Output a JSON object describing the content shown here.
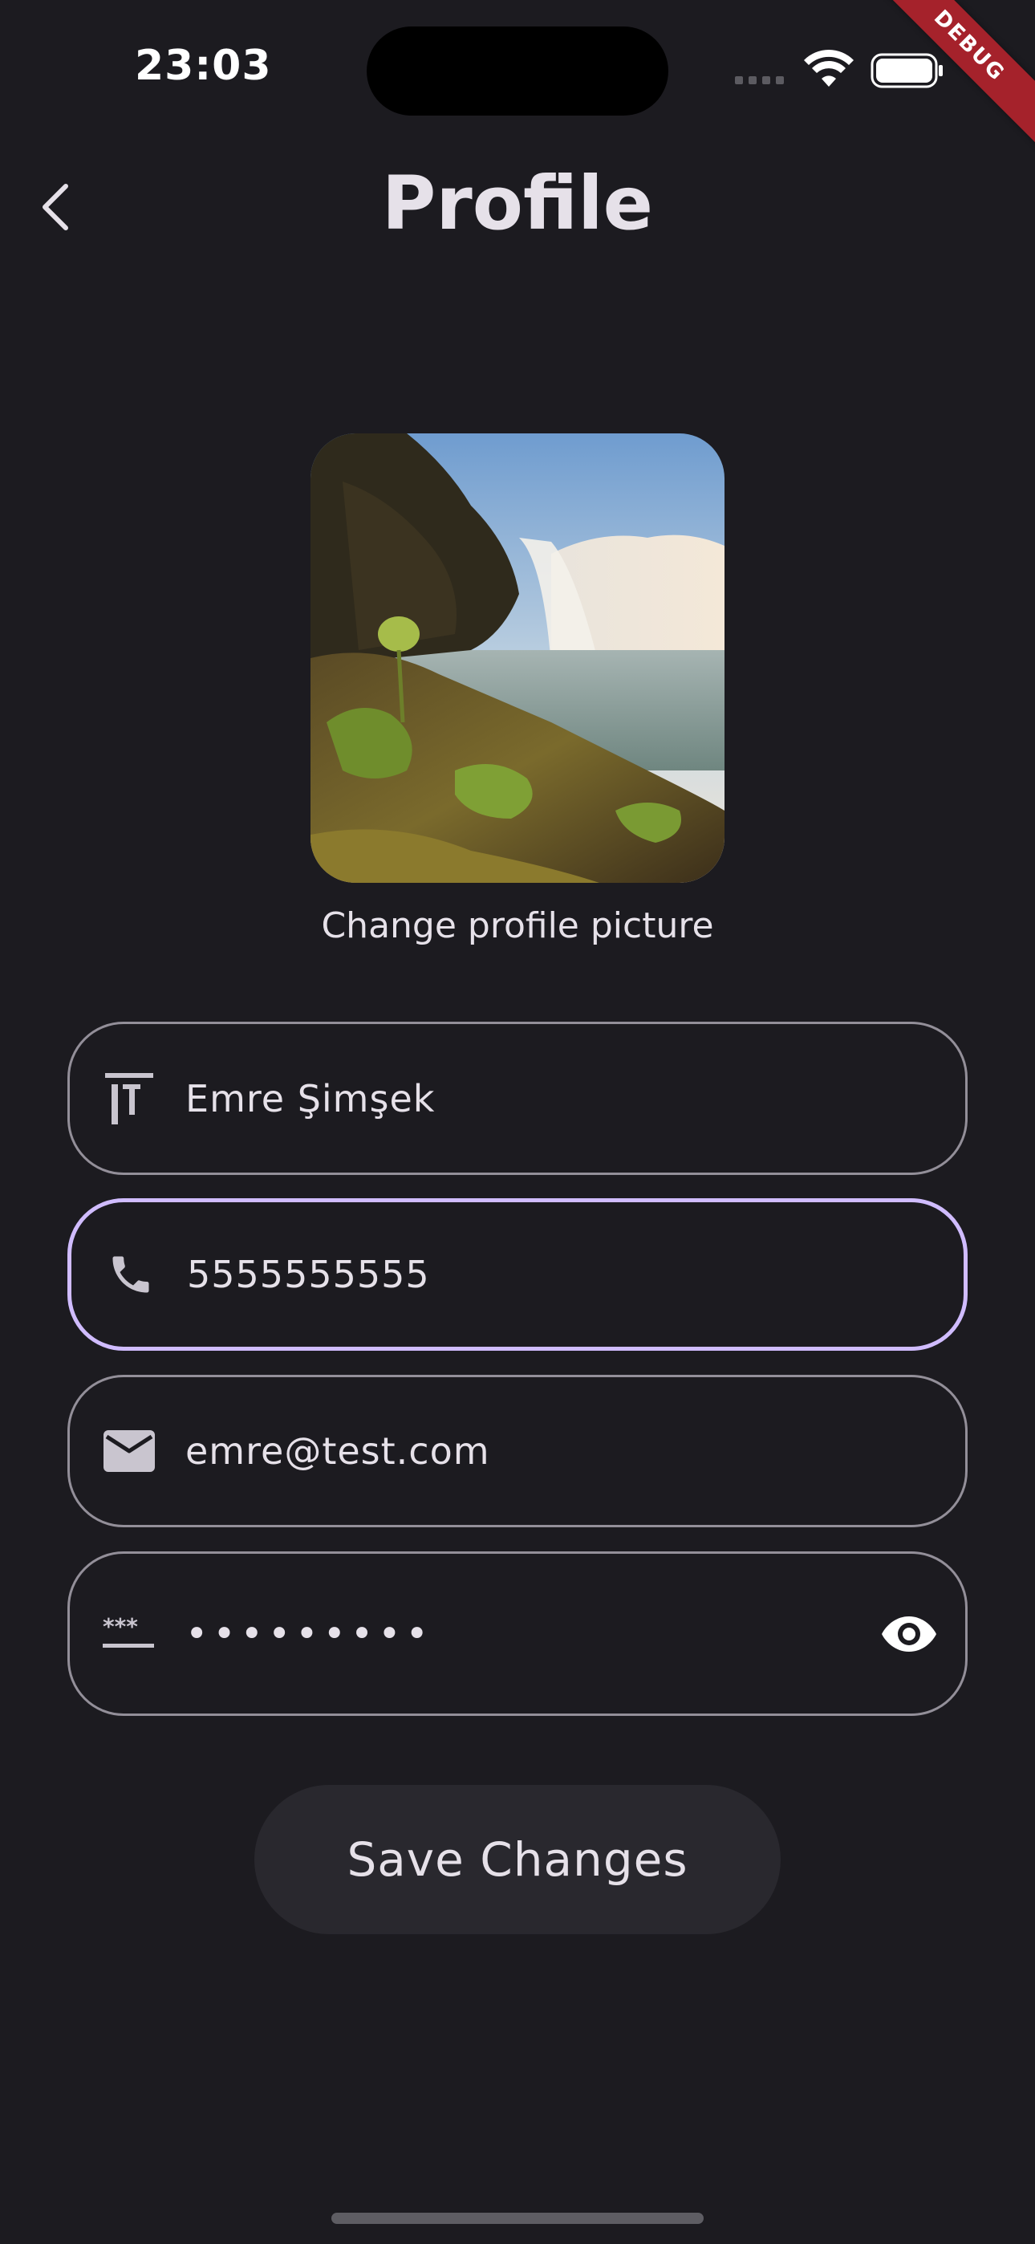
{
  "status_bar": {
    "time": "23:03",
    "debug_label": "DEBUG"
  },
  "header": {
    "title": "Profile",
    "back_icon": "chevron-left-icon"
  },
  "profile": {
    "image_alt": "waterfall landscape",
    "change_picture_label": "Change profile picture"
  },
  "form": {
    "name": {
      "value": "Emre Şimşek",
      "icon": "text-fields-icon"
    },
    "phone": {
      "value": "5555555555",
      "icon": "phone-icon"
    },
    "email": {
      "value": "emre@test.com",
      "icon": "mail-icon"
    },
    "password": {
      "value": "•••••••••",
      "icon": "password-icon",
      "toggle_icon": "visibility-icon"
    }
  },
  "actions": {
    "save_label": "Save Changes"
  },
  "colors": {
    "background": "#1c1b20",
    "text": "#e6e1e9",
    "outline": "#938f99",
    "focus": "#d0bcff",
    "button_bg": "#29282e",
    "debug": "#a5222b"
  }
}
